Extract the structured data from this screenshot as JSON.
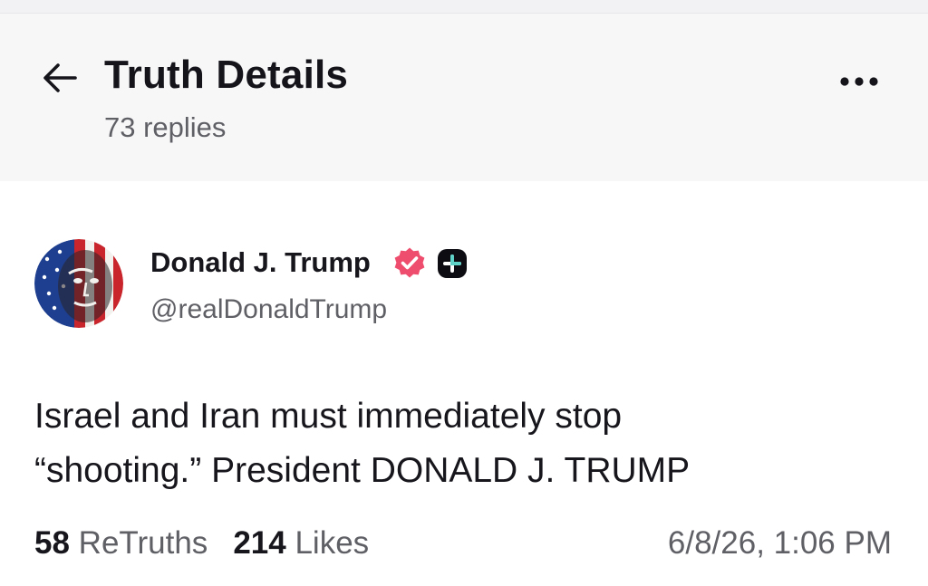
{
  "header": {
    "title": "Truth Details",
    "subtitle": "73 replies",
    "back_icon": "arrow-left-icon",
    "more_icon": "ellipsis-icon"
  },
  "post": {
    "author": {
      "name": "Donald J. Trump",
      "handle": "@realDonaldTrump",
      "verified_icon": "verified-badge-icon",
      "verified_color": "#ef4d6e",
      "plus_icon": "plus-badge-icon"
    },
    "body_lines": [
      "Israel and Iran must immediately stop",
      "“shooting.” President DONALD J. TRUMP"
    ],
    "stats": {
      "retruths_count": "58",
      "retruths_label": "ReTruths",
      "likes_count": "214",
      "likes_label": "Likes"
    },
    "timestamp": "6/8/26, 1:06 PM"
  }
}
